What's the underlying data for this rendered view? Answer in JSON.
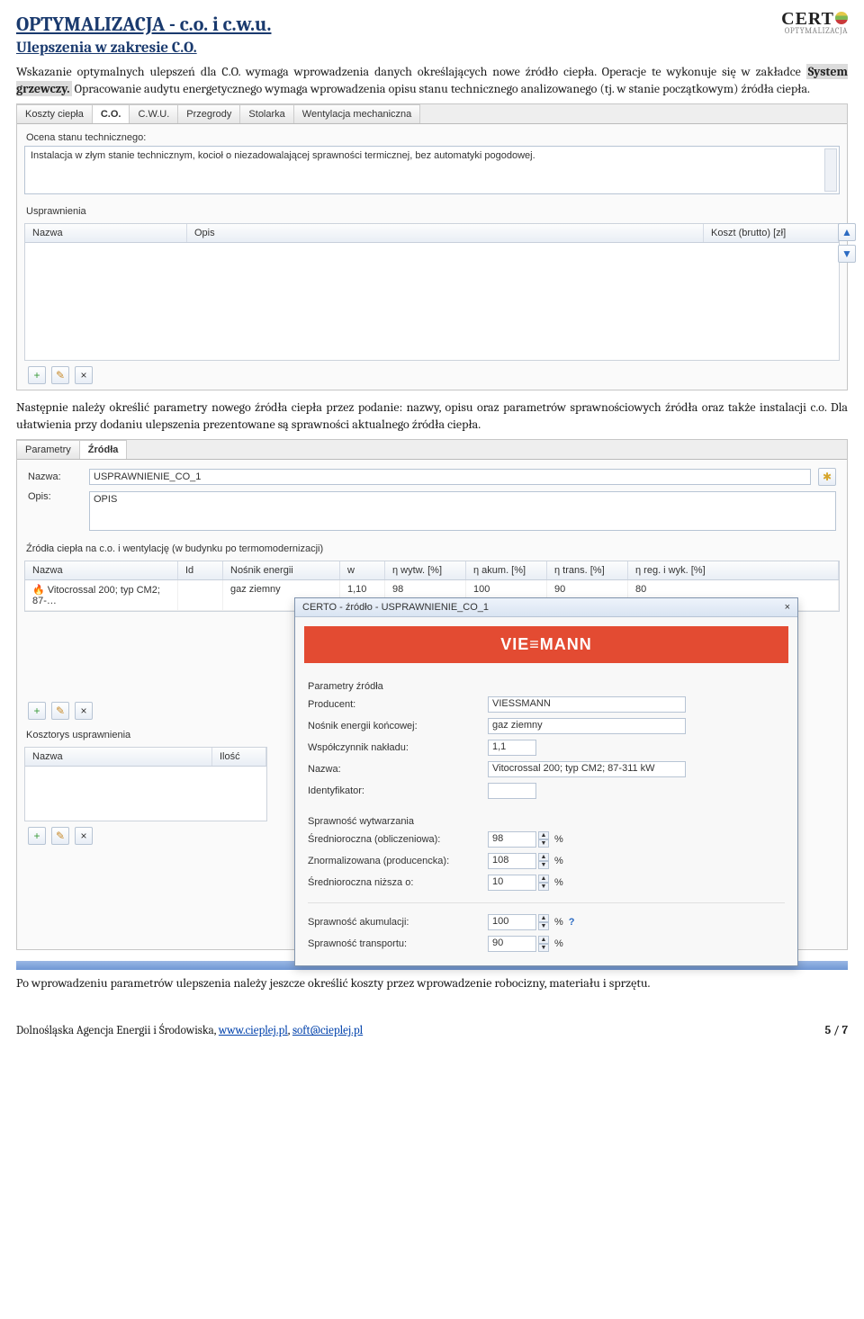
{
  "logo": {
    "brand_prefix": "CERT",
    "brand_sub": "OPTYMALIZACJA"
  },
  "header": {
    "title": "OPTYMALIZACJA - c.o. i c.w.u.",
    "subtitle": "Ulepszenia w zakresie C.O."
  },
  "intro": {
    "p1a": "Wskazanie optymalnych ulepszeń dla C.O. wymaga wprowadzenia danych określających nowe źródło ciepła. Operacje te wykonuje się w zakładce ",
    "p1_bold": "System grzewczy.",
    "p1b": " Opracowanie audytu energetycznego wymaga wprowadzenia opisu stanu technicznego analizowanego (tj. w stanie początkowym) źródła ciepła."
  },
  "shot1": {
    "tabs": [
      "Koszty ciepła",
      "C.O.",
      "C.W.U.",
      "Przegrody",
      "Stolarka",
      "Wentylacja mechaniczna"
    ],
    "active_tab_index": 1,
    "label_assessment": "Ocena stanu technicznego:",
    "assessment_text": "Instalacja w złym stanie technicznym, kocioł o niezadowalającej sprawności termicznej, bez automatyki pogodowej.",
    "improvements_label": "Usprawnienia",
    "table": {
      "col_name": "Nazwa",
      "col_desc": "Opis",
      "col_cost": "Koszt (brutto) [zł]"
    },
    "buttons": {
      "add": "+",
      "edit": "✎",
      "del": "×",
      "up": "▲",
      "down": "▼"
    }
  },
  "mid": {
    "p": "Następnie należy określić parametry nowego źródła ciepła przez podanie: nazwy, opisu oraz parametrów sprawnościowych źródła oraz także instalacji c.o. Dla ułatwienia przy dodaniu ulepszenia prezentowane są sprawności aktualnego źródła ciepła."
  },
  "shot2": {
    "tabs": [
      "Parametry",
      "Źródła"
    ],
    "active_tab_index": 1,
    "label_name": "Nazwa:",
    "value_name": "USPRAWNIENIE_CO_1",
    "label_desc": "Opis:",
    "value_desc": "OPIS",
    "sources_label": "Źródła ciepła na c.o. i wentylację (w budynku po termomodernizacji)",
    "sources_cols": {
      "name": "Nazwa",
      "id": "Id",
      "carrier": "Nośnik energii",
      "w": "w",
      "eta_w": "η wytw. [%]",
      "eta_a": "η akum. [%]",
      "eta_t": "η trans. [%]",
      "eta_r": "η reg. i wyk. [%]"
    },
    "source_row": {
      "name": "Vitocrossal 200; typ CM2; 87-…",
      "id": "",
      "carrier": "gaz ziemny",
      "w": "1,10",
      "eta_w": "98",
      "eta_a": "100",
      "eta_t": "90",
      "eta_r": "80"
    },
    "kosztorys_label": "Kosztorys usprawnienia",
    "kosztorys_cols": {
      "name": "Nazwa",
      "qty": "Ilość"
    },
    "buttons": {
      "add": "+",
      "edit": "✎",
      "del": "×"
    }
  },
  "dialog": {
    "title": "CERTO - źródło - USPRAWNIENIE_CO_1",
    "close": "×",
    "brand": "VIE≡MANN",
    "sect_params": "Parametry źródła",
    "rows": {
      "producer_l": "Producent:",
      "producer_v": "VIESSMANN",
      "carrier_l": "Nośnik energii końcowej:",
      "carrier_v": "gaz ziemny",
      "coeff_l": "Współczynnik nakładu:",
      "coeff_v": "1,1",
      "name_l": "Nazwa:",
      "name_v": "Vitocrossal 200; typ CM2; 87-311 kW",
      "id_l": "Identyfikator:",
      "id_v": ""
    },
    "sect_eff": "Sprawność wytwarzania",
    "eff": {
      "avg_l": "Średnioroczna (obliczeniowa):",
      "avg_v": "98",
      "avg_u": "%",
      "norm_l": "Znormalizowana (producencka):",
      "norm_v": "108",
      "norm_u": "%",
      "low_l": "Średnioroczna niższa o:",
      "low_v": "10",
      "low_u": "%"
    },
    "akum_l": "Sprawność akumulacji:",
    "akum_v": "100",
    "akum_u": "%",
    "trans_l": "Sprawność transportu:",
    "trans_v": "90",
    "trans_u": "%"
  },
  "outro": {
    "p": "Po wprowadzeniu parametrów ulepszenia należy jeszcze określić koszty przez wprowadzenie robocizny, materiału i sprzętu."
  },
  "footer": {
    "org": "Dolnośląska Agencja Energii i Środowiska, ",
    "link1": "www.cieplej.pl",
    "sep": ", ",
    "link2": "soft@cieplej.pl",
    "page": "5 / 7"
  }
}
